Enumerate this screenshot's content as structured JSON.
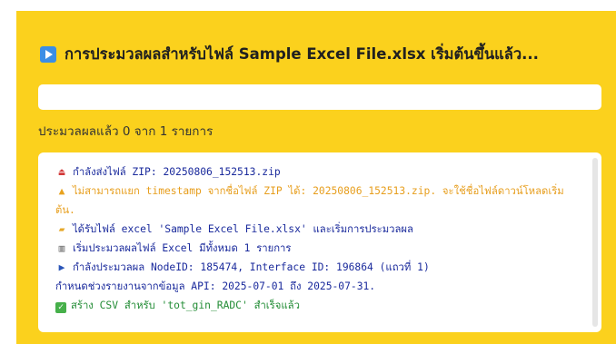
{
  "header": {
    "title": "การประมวลผลสำหรับไฟล์ Sample Excel File.xlsx เริ่มต้นขึ้นแล้ว...",
    "icon": "play-button-icon",
    "icon_color": "#3b8ee5"
  },
  "progress": {
    "fraction": 0,
    "text": "ประมวลผลแล้ว 0 จาก 1 รายการ"
  },
  "log": [
    {
      "kind": "info",
      "icon": "upload-icon",
      "glyph": "⏏",
      "text": "กำลังส่งไฟล์ ZIP: 20250806_152513.zip"
    },
    {
      "kind": "warn",
      "icon": "warning-icon",
      "glyph": "▲",
      "text": "ไม่สามารถแยก timestamp จากชื่อไฟล์ ZIP ได้: 20250806_152513.zip. จะใช้ชื่อไฟล์ดาวน์โหลดเริ่มต้น."
    },
    {
      "kind": "info",
      "icon": "folder-icon",
      "glyph": "▰",
      "text": "ได้รับไฟล์ excel 'Sample Excel File.xlsx' และเริ่มการประมวลผล"
    },
    {
      "kind": "info",
      "icon": "bar-chart-icon",
      "glyph": "▥",
      "text": "เริ่มประมวลผลไฟล์ Excel มีทั้งหมด 1 รายการ"
    },
    {
      "kind": "info",
      "icon": "play-icon",
      "glyph": "▶",
      "text": "กำลังประมวลผล NodeID: 185474, Interface ID: 196864 (แถวที่ 1)"
    },
    {
      "kind": "info",
      "icon": "",
      "glyph": "",
      "text": "กำหนดช่วงรายงานจากข้อมูล API: 2025-07-01 ถึง 2025-07-31."
    },
    {
      "kind": "success",
      "icon": "check-icon",
      "glyph": "✓",
      "text": "สร้าง CSV สำหรับ 'tot_gin_RADC' สำเร็จแล้ว"
    }
  ],
  "colors": {
    "panel": "#fbd11d",
    "info": "#1a2a9c",
    "warn": "#e79e1d",
    "success": "#228c35"
  }
}
